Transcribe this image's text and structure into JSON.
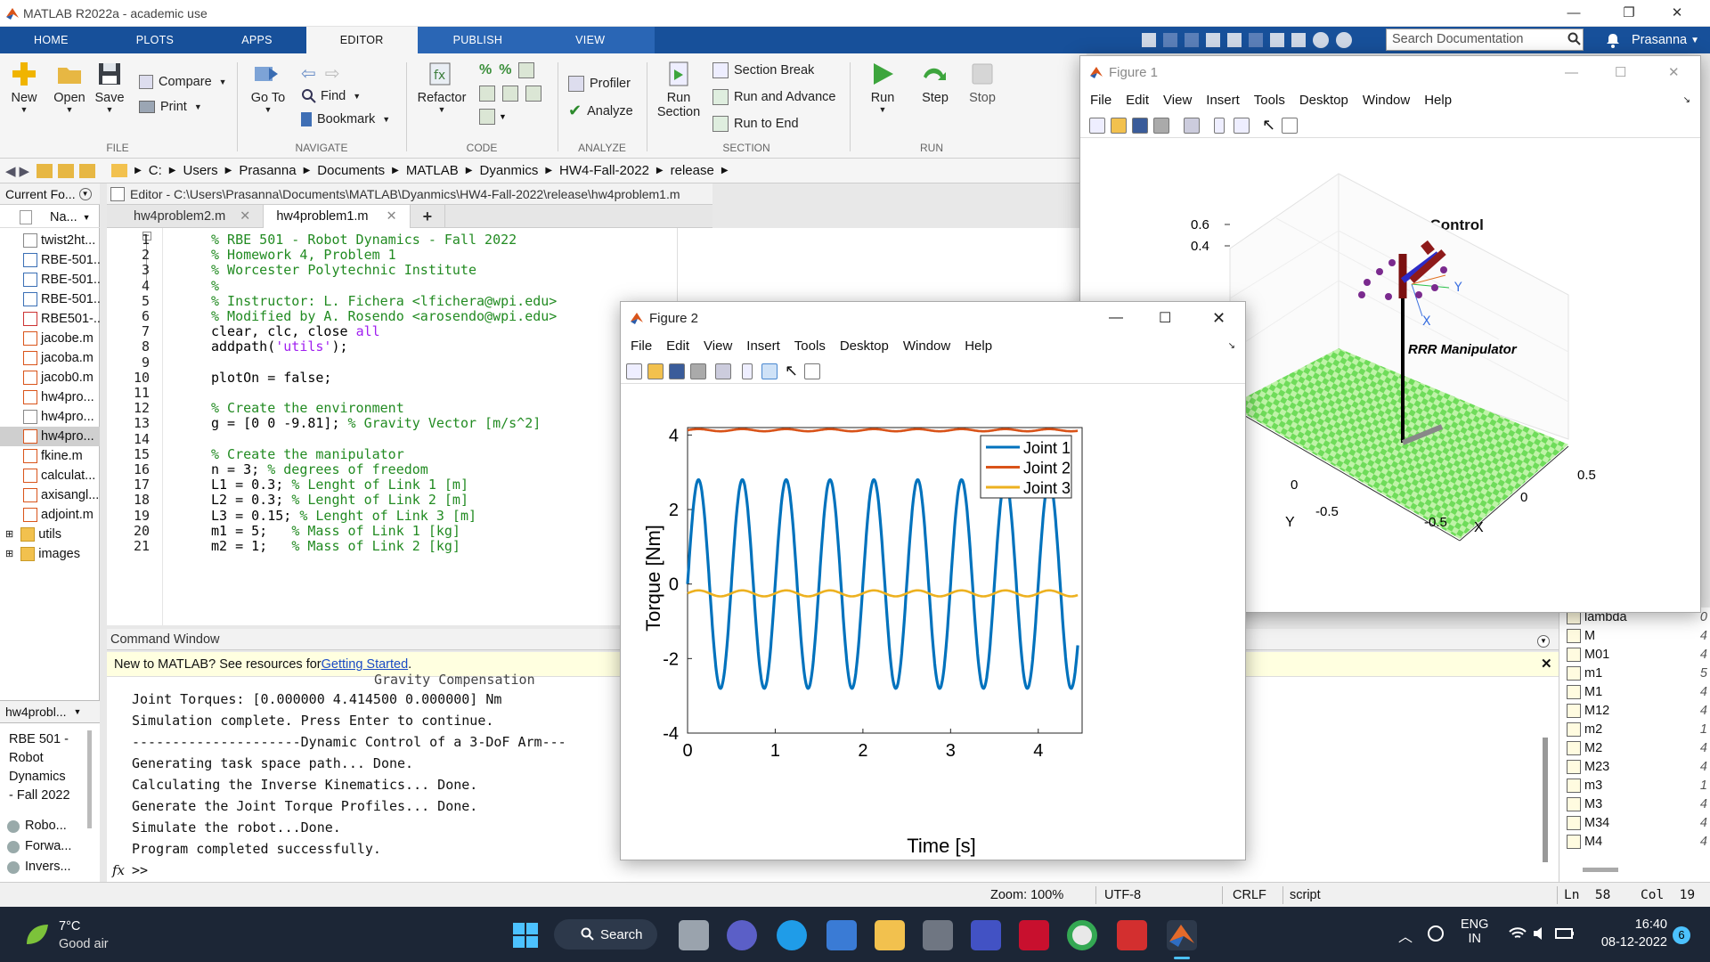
{
  "app": {
    "title": "MATLAB R2022a - academic use"
  },
  "tabs": [
    "HOME",
    "PLOTS",
    "APPS",
    "EDITOR",
    "PUBLISH",
    "VIEW"
  ],
  "ribbon": {
    "new": "New",
    "open": "Open",
    "save": "Save",
    "compare": "Compare",
    "print": "Print",
    "file_group": "FILE",
    "goto": "Go To",
    "find": "Find",
    "bookmark": "Bookmark",
    "navigate_group": "NAVIGATE",
    "refactor": "Refactor",
    "code_group": "CODE",
    "profiler": "Profiler",
    "analyze": "Analyze",
    "analyze_group": "ANALYZE",
    "run_section": "Run Section",
    "run_section_l1": "Run",
    "run_section_l2": "Section",
    "section_break": "Section Break",
    "run_and_advance": "Run and Advance",
    "run_to_end": "Run to End",
    "section_group": "SECTION",
    "run": "Run",
    "step": "Step",
    "stop": "Stop",
    "run_group": "RUN"
  },
  "search": {
    "placeholder": "Search Documentation"
  },
  "user": "Prasanna",
  "path": [
    "C:",
    "Users",
    "Prasanna",
    "Documents",
    "MATLAB",
    "Dyanmics",
    "HW4-Fall-2022",
    "release"
  ],
  "current_folder": {
    "title": "Current Fo...",
    "col": "Na...",
    "items": [
      "twist2ht...",
      "RBE-501...",
      "RBE-501...",
      "RBE-501...",
      "RBE501-...",
      "jacobe.m",
      "jacoba.m",
      "jacob0.m",
      "hw4pro...",
      "hw4pro...",
      "hw4pro...",
      "fkine.m",
      "calculat...",
      "axisangl...",
      "adjoint.m",
      "utils",
      "images"
    ]
  },
  "details": {
    "title": "hw4probl...",
    "text": "RBE 501 - Robot Dynamics - Fall 2022",
    "text_l1": "RBE 501 -",
    "text_l2": "Robot",
    "text_l3": "Dynamics",
    "text_l4": "- Fall 2022",
    "items": [
      "Robo...",
      "Forwa...",
      "Invers..."
    ]
  },
  "editor": {
    "header": "Editor - C:\\Users\\Prasanna\\Documents\\MATLAB\\Dyanmics\\HW4-Fall-2022\\release\\hw4problem1.m",
    "tabs": [
      "hw4problem2.m",
      "hw4problem1.m"
    ],
    "plus": "+",
    "close": "✕"
  },
  "code": [
    {
      "n": "1",
      "t": "% RBE 501 - Robot Dynamics - Fall 2022"
    },
    {
      "n": "2",
      "t": "% Homework 4, Problem 1"
    },
    {
      "n": "3",
      "t": "% Worcester Polytechnic Institute"
    },
    {
      "n": "4",
      "t": "%"
    },
    {
      "n": "5",
      "t": "% Instructor: L. Fichera <lfichera@wpi.edu>"
    },
    {
      "n": "6",
      "t": "% Modified by A. Rosendo <arosendo@wpi.edu>"
    },
    {
      "n": "7",
      "t": "clear, clc, close all"
    },
    {
      "n": "8",
      "t": "addpath('utils');"
    },
    {
      "n": "9",
      "t": ""
    },
    {
      "n": "10",
      "t": "plotOn = false;"
    },
    {
      "n": "11",
      "t": ""
    },
    {
      "n": "12",
      "t": "% Create the environment"
    },
    {
      "n": "13",
      "t": "g = [0 0 -9.81]; % Gravity Vector [m/s^2]"
    },
    {
      "n": "14",
      "t": ""
    },
    {
      "n": "15",
      "t": "% Create the manipulator"
    },
    {
      "n": "16",
      "t": "n = 3; % degrees of freedom"
    },
    {
      "n": "17",
      "t": "L1 = 0.3; % Lenght of Link 1 [m]"
    },
    {
      "n": "18",
      "t": "L2 = 0.3; % Lenght of Link 2 [m]"
    },
    {
      "n": "19",
      "t": "L3 = 0.15; % Lenght of Link 3 [m]"
    },
    {
      "n": "20",
      "t": "m1 = 5;   % Mass of Link 1 [kg]"
    },
    {
      "n": "21",
      "t": "m2 = 1;   % Mass of Link 2 [kg]"
    }
  ],
  "command": {
    "title": "Command Window",
    "new_msg": "New to MATLAB? See resources for ",
    "link": "Getting Started",
    "period": ".",
    "lines": [
      "Joint Torques: [0.000000 4.414500 0.000000] Nm",
      "Simulation complete. Press Enter to continue.",
      "---------------------Dynamic Control of a 3-DoF Arm---",
      "Generating task space path... Done.",
      "Calculating the Inverse Kinematics... Done.",
      "Generate the Joint Torque Profiles... Done.",
      "Simulate the robot...Done.",
      "Program completed successfully."
    ],
    "cut_line": "Gravity Compensation",
    "prompt": ">>",
    "fx": "fx"
  },
  "workspace": [
    {
      "name": "lambda",
      "val": "0"
    },
    {
      "name": "M",
      "val": "4"
    },
    {
      "name": "M01",
      "val": "4"
    },
    {
      "name": "m1",
      "val": "5"
    },
    {
      "name": "M1",
      "val": "4"
    },
    {
      "name": "M12",
      "val": "4"
    },
    {
      "name": "m2",
      "val": "1"
    },
    {
      "name": "M2",
      "val": "4"
    },
    {
      "name": "M23",
      "val": "4"
    },
    {
      "name": "m3",
      "val": "1"
    },
    {
      "name": "M3",
      "val": "4"
    },
    {
      "name": "M34",
      "val": "4"
    },
    {
      "name": "M4",
      "val": "4"
    }
  ],
  "status": {
    "zoom": "Zoom: 100%",
    "enc": "UTF-8",
    "eol": "CRLF",
    "type": "script",
    "ln": "Ln  58",
    "col": "Col  19"
  },
  "taskbar": {
    "temp": "7°C",
    "air": "Good air",
    "search": "Search",
    "lang1": "ENG",
    "lang2": "IN",
    "time": "16:40",
    "date": "08-12-2022",
    "badge": "6"
  },
  "figure1": {
    "title": "Figure 1",
    "menu": [
      "File",
      "Edit",
      "View",
      "Insert",
      "Tools",
      "Desktop",
      "Window",
      "Help"
    ],
    "plot_title": "Inverse Dynamics Control",
    "label": "RRR Manipulator",
    "zticks": [
      "0.6",
      "0.4"
    ],
    "yticks": [
      "0",
      "-0.5"
    ],
    "xticks": [
      "0.5",
      "0",
      "-0.5"
    ],
    "xlabel": "X",
    "ylabel": "Y",
    "axis_x": "X",
    "axis_y": "Y"
  },
  "figure2": {
    "title": "Figure 2",
    "menu": [
      "File",
      "Edit",
      "View",
      "Insert",
      "Tools",
      "Desktop",
      "Window",
      "Help"
    ]
  },
  "chart_data": {
    "type": "line",
    "title": "",
    "xlabel": "Time [s]",
    "ylabel": "Torque [Nm]",
    "xlim": [
      0,
      4.5
    ],
    "ylim": [
      -4,
      4.2
    ],
    "xticks": [
      0,
      1,
      2,
      3,
      4
    ],
    "yticks": [
      -4,
      -2,
      0,
      2,
      4
    ],
    "legend_position": "top-right",
    "series": [
      {
        "name": "Joint 1",
        "color": "#0072BD",
        "amplitude": 2.8,
        "period": 0.5,
        "offset": 0
      },
      {
        "name": "Joint 2",
        "color": "#D95319",
        "amplitude": 0.03,
        "period": 0.5,
        "offset": 4.13
      },
      {
        "name": "Joint 3",
        "color": "#EDB120",
        "amplitude": 0.08,
        "period": 0.5,
        "offset": -0.25
      }
    ]
  }
}
